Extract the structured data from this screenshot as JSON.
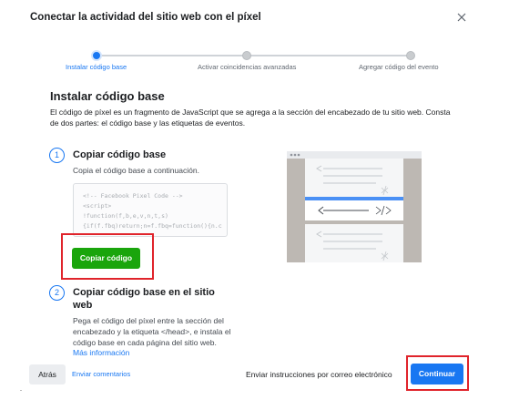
{
  "dialog": {
    "title": "Conectar la actividad del sitio web con el píxel"
  },
  "stepper": {
    "steps": [
      {
        "label": "Instalar código base",
        "active": true
      },
      {
        "label": "Activar coincidencias avanzadas",
        "active": false
      },
      {
        "label": "Agregar código del evento",
        "active": false
      }
    ]
  },
  "main": {
    "title": "Instalar código base",
    "description": "El código de píxel es un fragmento de JavaScript que se agrega a la sección del encabezado de tu sitio web. Consta de dos partes: el código base y las etiquetas de eventos.",
    "step1": {
      "number": "1",
      "title": "Copiar código base",
      "subtitle": "Copia el código base a continuación.",
      "code_lines": [
        "<!-- Facebook Pixel Code -->",
        "<script>",
        "!function(f,b,e,v,n,t,s)",
        "{if(f.fbq)return;n=f.fbq=function(){n.c"
      ],
      "copy_button": "Copiar código"
    },
    "step2": {
      "number": "2",
      "title": "Copiar código base en el sitio web",
      "description": "Pega el código del píxel entre la sección del encabezado y la etiqueta </head>, e instala el código base en cada página del sitio web.",
      "more_link": "Más información"
    }
  },
  "footer": {
    "back_button": "Atrás",
    "feedback_link": "Enviar comentarios",
    "email_link": "Enviar instrucciones por correo electrónico",
    "continue_button": "Continuar"
  },
  "colors": {
    "accent": "#1877f2",
    "copy_button": "#1aa50c",
    "highlight": "#e0242b"
  }
}
